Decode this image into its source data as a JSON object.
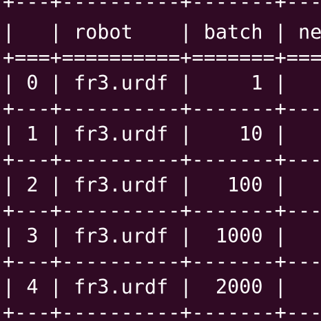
{
  "terminal": {
    "background": "#300a24",
    "foreground": "#ffffff",
    "lines": [
      "+---+----------+-------+-----",
      "|   | robot    | batch | new",
      "+===+==========+=======+=====",
      "| 0 | fr3.urdf |     1 |",
      "+---+----------+-------+-----",
      "| 1 | fr3.urdf |    10 |",
      "+---+----------+-------+-----",
      "| 2 | fr3.urdf |   100 |",
      "+---+----------+-------+-----",
      "| 3 | fr3.urdf |  1000 |",
      "+---+----------+-------+-----",
      "| 4 | fr3.urdf |  2000 |",
      "+---+----------+-------+-----"
    ]
  }
}
